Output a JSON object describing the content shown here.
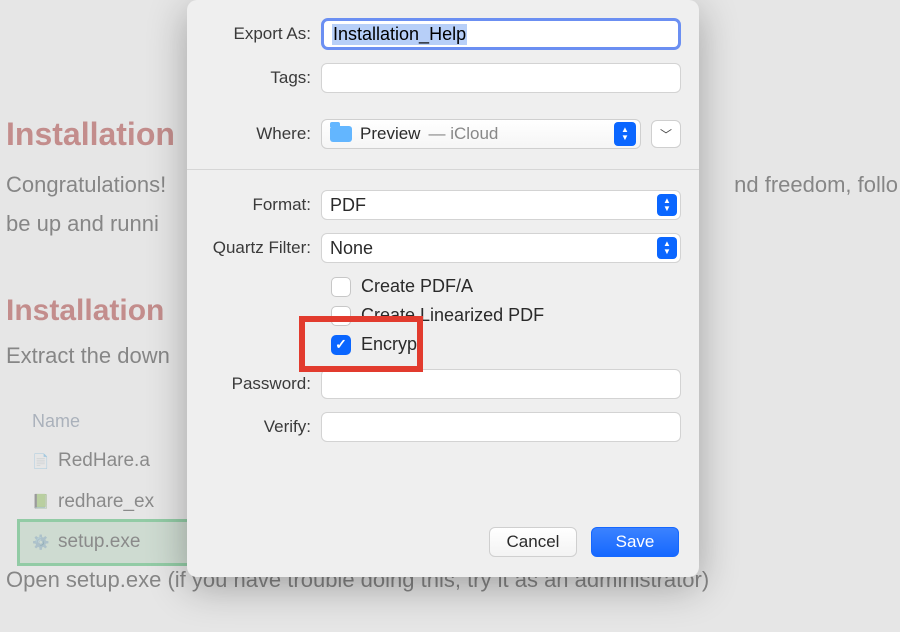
{
  "bg": {
    "h1": "Installation",
    "p1": "Congratulations!",
    "p1_tail": "nd freedom, follo",
    "p2": "be up and runni",
    "h2": "Installation",
    "p3": "Extract the down",
    "name_col": "Name",
    "files": [
      {
        "icon": "app-icon",
        "label": "RedHare.a"
      },
      {
        "icon": "xls-icon",
        "label": "redhare_ex"
      },
      {
        "icon": "exe-icon",
        "label": "setup.exe"
      }
    ],
    "foot": "Open setup.exe (if you have trouble doing this, try it as an administrator)"
  },
  "dialog": {
    "export_as_label": "Export As:",
    "export_as_value": "Installation_Help",
    "tags_label": "Tags:",
    "where_label": "Where:",
    "where_folder": "Preview",
    "where_suffix": " — iCloud",
    "format_label": "Format:",
    "format_value": "PDF",
    "quartz_label": "Quartz Filter:",
    "quartz_value": "None",
    "opt_pdfa": "Create PDF/A",
    "opt_lin": "Create Linearized PDF",
    "opt_enc": "Encrypt",
    "opt_enc_checked": true,
    "password_label": "Password:",
    "verify_label": "Verify:",
    "cancel": "Cancel",
    "save": "Save"
  }
}
